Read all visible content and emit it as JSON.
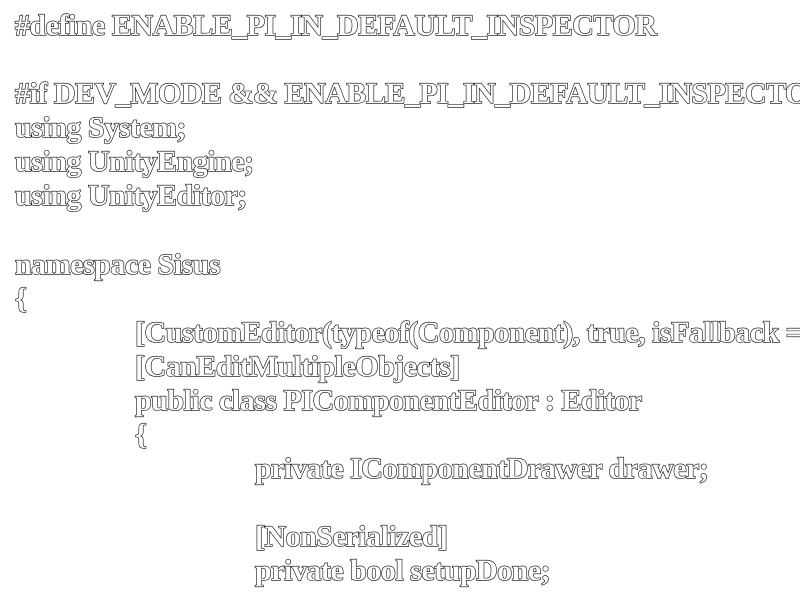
{
  "code_lines": {
    "define": "#define ENABLE_PI_IN_DEFAULT_INSPECTOR",
    "if_directive": "#if DEV_MODE && ENABLE_PI_IN_DEFAULT_INSPECTOR",
    "using_system": "using System;",
    "using_unityengine": "using UnityEngine;",
    "using_unityeditor": "using UnityEditor;",
    "namespace_decl": "namespace Sisus",
    "namespace_open_brace": "{",
    "custom_editor_attr": "[CustomEditor(typeof(Component), true, isFallback = true)]",
    "can_edit_multiple_attr": "[CanEditMultipleObjects]",
    "class_decl": "public class PIComponentEditor : Editor",
    "class_open_brace": "{",
    "drawer_field": "private IComponentDrawer drawer;",
    "nonserialized_attr": "[NonSerialized]",
    "setup_done_field": "private bool setupDone;"
  }
}
